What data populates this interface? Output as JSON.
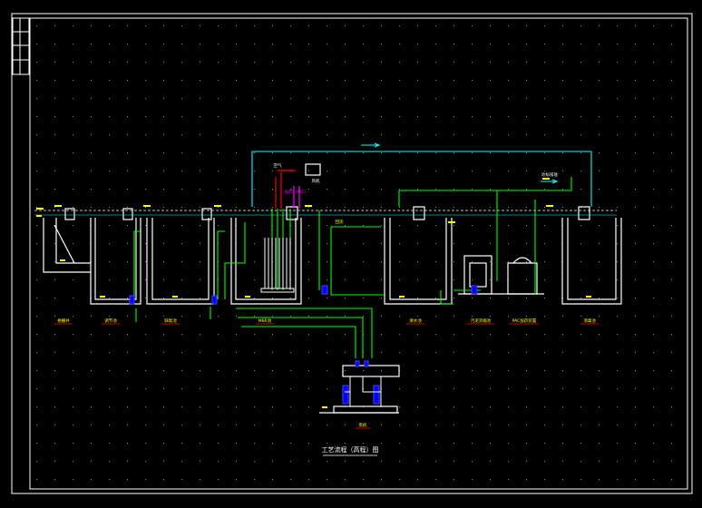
{
  "drawing": {
    "title": "工艺流程（高程）图",
    "colors": {
      "background": "#000000",
      "frame": "#ffffff",
      "grid_dot": "#8a8a8a",
      "structure": "#ffffff",
      "water_line": "#00ffff",
      "sludge_line": "#00ff00",
      "air_line": "#ff0000",
      "chemical_line": "#ff00ff",
      "pump": "#0000ff",
      "label": "#ffff00",
      "label_bar": "#ff0000"
    },
    "tank_labels": [
      "格栅井",
      "调节池",
      "缺氧池",
      "MBR池",
      "清水池",
      "污泥浓缩池",
      "PAC加药装置",
      "消毒池"
    ],
    "pump_room_label": "泵房",
    "annotations": {
      "air_inlet": "空气",
      "chemical_dosing": "加药（PAC）",
      "blower": "风机",
      "return_sludge": "回流",
      "discharge": "达标排放"
    }
  }
}
